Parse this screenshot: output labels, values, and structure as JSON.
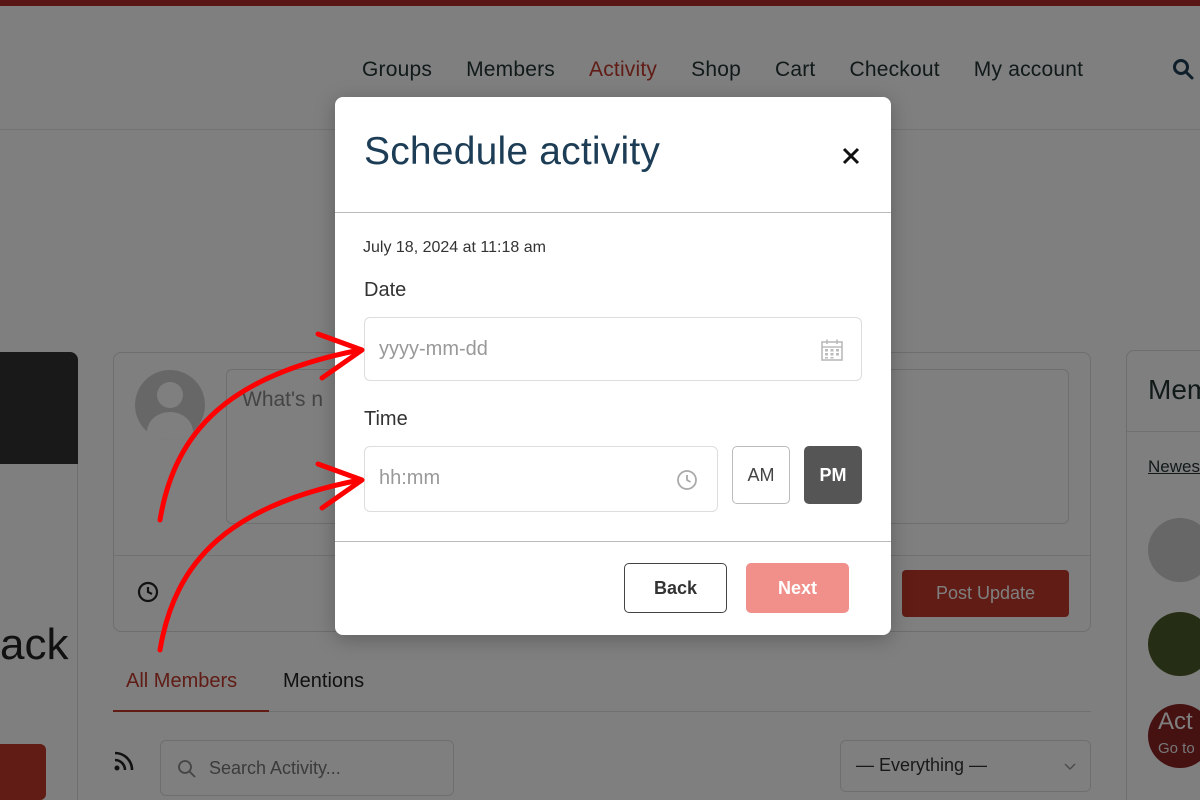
{
  "nav": {
    "items": [
      "Groups",
      "Members",
      "Activity",
      "Shop",
      "Cart",
      "Checkout",
      "My account"
    ],
    "active": "Activity"
  },
  "page": {
    "left_partial_text": "ack",
    "composer_placeholder": "What's n",
    "post_button": "Post Update",
    "tabs": [
      "All Members",
      "Mentions"
    ],
    "search_placeholder": "Search Activity...",
    "filter_value": "— Everything —",
    "sidebar_title": "Mem",
    "sidebar_link": "Newes",
    "sidebar_avatar_text": "Act",
    "sidebar_avatar_sub": "Go to"
  },
  "modal": {
    "title": "Schedule activity",
    "timestamp": "July 18, 2024 at 11:18 am",
    "date_label": "Date",
    "date_placeholder": "yyyy-mm-dd",
    "time_label": "Time",
    "time_placeholder": "hh:mm",
    "am_label": "AM",
    "pm_label": "PM",
    "back_label": "Back",
    "next_label": "Next"
  },
  "colors": {
    "brand_red": "#c0392b",
    "title_blue": "#1c3d55",
    "next_disabled": "#f1908a",
    "pm_selected": "#555555",
    "annotation_arrow": "#ff0000"
  },
  "icons": [
    "search-icon",
    "close-icon",
    "calendar-icon",
    "clock-icon",
    "rss-icon",
    "chevron-down-icon",
    "avatar"
  ]
}
